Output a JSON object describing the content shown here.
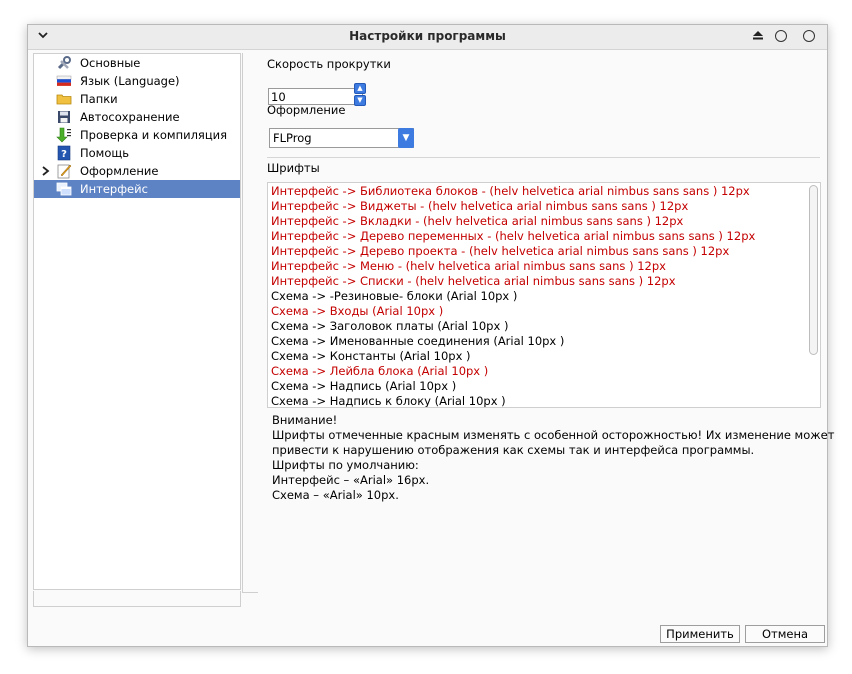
{
  "window": {
    "title": "Настройки программы"
  },
  "titlebar": {
    "collapse_icon": "chevron-down-icon",
    "eject_icon": "eject-icon",
    "minimize_icon": "circle-icon",
    "maximize_icon": "circle-icon"
  },
  "sidebar": {
    "items": [
      {
        "label": "Основные",
        "icon": "tools-icon"
      },
      {
        "label": "Язык (Language)",
        "icon": "flag-icon"
      },
      {
        "label": "Папки",
        "icon": "folder-icon"
      },
      {
        "label": "Автосохранение",
        "icon": "floppy-disk-icon"
      },
      {
        "label": "Проверка и компиляция",
        "icon": "compile-arrow-icon"
      },
      {
        "label": "Помощь",
        "icon": "help-icon"
      },
      {
        "label": "Оформление",
        "icon": "pencil-paper-icon",
        "expandable": true
      },
      {
        "label": "Интерфейс",
        "icon": "windows-icon",
        "selected": true
      }
    ]
  },
  "main": {
    "scroll_speed": {
      "label": "Скорость прокрутки",
      "value": "10"
    },
    "theme": {
      "label": "Оформление",
      "value": "FLProg"
    },
    "fonts": {
      "label": "Шрифты",
      "items": [
        {
          "text": "Интерфейс -> Библиотека блоков - (helv helvetica arial nimbus sans sans ) 12px",
          "red": true
        },
        {
          "text": "Интерфейс -> Виджеты - (helv helvetica arial nimbus sans sans ) 12px",
          "red": true
        },
        {
          "text": "Интерфейс -> Вкладки - (helv helvetica arial nimbus sans sans ) 12px",
          "red": true
        },
        {
          "text": "Интерфейс -> Дерево переменных - (helv helvetica arial nimbus sans sans ) 12px",
          "red": true
        },
        {
          "text": "Интерфейс -> Дерево проекта - (helv helvetica arial nimbus sans sans ) 12px",
          "red": true
        },
        {
          "text": "Интерфейс -> Меню - (helv helvetica arial nimbus sans sans ) 12px",
          "red": true
        },
        {
          "text": "Интерфейс -> Списки - (helv helvetica arial nimbus sans sans ) 12px",
          "red": true
        },
        {
          "text": "Схема -> -Резиновые- блоки (Arial 10px )",
          "red": false
        },
        {
          "text": "Схема -> Входы (Arial 10px )",
          "red": true
        },
        {
          "text": "Схема -> Заголовок платы (Arial 10px )",
          "red": false
        },
        {
          "text": "Схема -> Именованные соединения (Arial 10px )",
          "red": false
        },
        {
          "text": "Схема -> Константы (Arial 10px )",
          "red": false
        },
        {
          "text": "Схема -> Лейбла блока (Arial 10px )",
          "red": true
        },
        {
          "text": "Схема -> Надпись (Arial 10px )",
          "red": false
        },
        {
          "text": "Схема -> Надпись к блоку (Arial 10px )",
          "red": false
        }
      ]
    },
    "notes": [
      "Внимание!",
      "Шрифты отмеченные красным изменять с особенной осторожностью! Их изменение может",
      "привести к нарушению отображения как схемы так и интерфейса программы.",
      "Шрифты по умолчанию:",
      "Интерфейс – «Arial» 16px.",
      "Схема – «Arial» 10px."
    ]
  },
  "buttons": {
    "apply": "Применить",
    "cancel": "Отмена"
  },
  "colors": {
    "selection": "#5e83c4",
    "warning_text": "#c40000",
    "accent": "#3d7be0"
  }
}
